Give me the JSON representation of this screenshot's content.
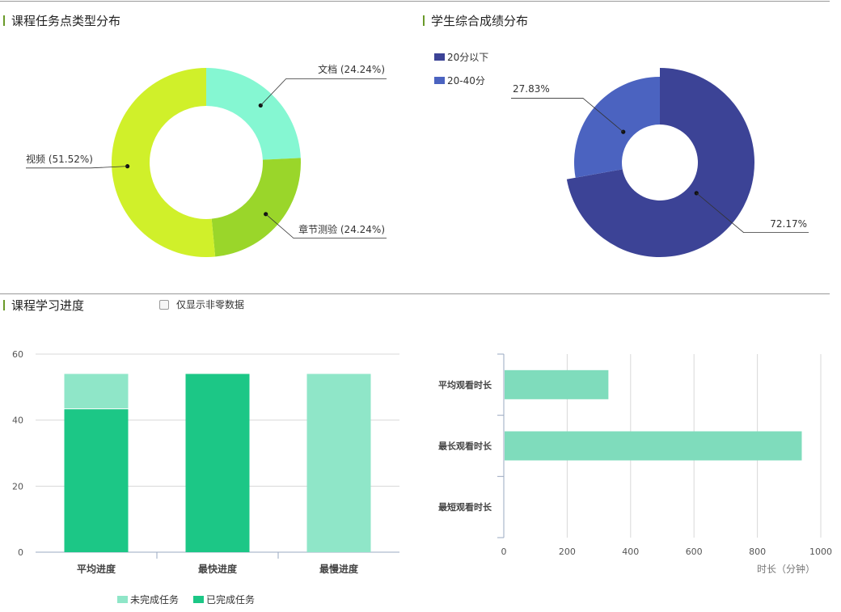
{
  "sections": {
    "task_type_title": "课程任务点类型分布",
    "score_title": "学生综合成绩分布",
    "progress_title": "课程学习进度"
  },
  "filter": {
    "nonzero_label": "仅显示非零数据",
    "checked": false
  },
  "colors": {
    "title_marker": "#6a9a2a",
    "doc": "#85f7d2",
    "quiz": "#9ad62a",
    "video": "#d0f02a",
    "below20": "#3c4396",
    "range20_40": "#4b63c0",
    "unfinished": "#8fe6c8",
    "finished": "#1cc786",
    "duration_bar": "#7fdcbc"
  },
  "chart_data": [
    {
      "type": "pie",
      "subtype": "donut",
      "title": "课程任务点类型分布",
      "slices": [
        {
          "name": "文档",
          "value": 24.24,
          "label": "文档 (24.24%)"
        },
        {
          "name": "章节测验",
          "value": 24.24,
          "label": "章节测验 (24.24%)"
        },
        {
          "name": "视频",
          "value": 51.52,
          "label": "视频 (51.52%)"
        }
      ]
    },
    {
      "type": "pie",
      "subtype": "donut",
      "title": "学生综合成绩分布",
      "legend_position": "top-left",
      "slices": [
        {
          "name": "20分以下",
          "value": 72.17,
          "label": "72.17%"
        },
        {
          "name": "20-40分",
          "value": 27.83,
          "label": "27.83%"
        }
      ]
    },
    {
      "type": "bar",
      "subtype": "stacked",
      "categories": [
        "平均进度",
        "最快进度",
        "最慢进度"
      ],
      "series": [
        {
          "name": "已完成任务",
          "values": [
            43.3,
            54,
            0
          ]
        },
        {
          "name": "未完成任务",
          "values": [
            10.7,
            0,
            54
          ]
        }
      ],
      "legend_order": [
        "未完成任务",
        "已完成任务"
      ],
      "legend_position": "bottom",
      "ylim": [
        0,
        60
      ],
      "yticks": [
        0,
        20,
        40,
        60
      ],
      "grid": true
    },
    {
      "type": "bar",
      "orientation": "horizontal",
      "categories": [
        "平均观看时长",
        "最长观看时长",
        "最短观看时长"
      ],
      "values": [
        330,
        940,
        0
      ],
      "xlabel": "时长（分钟）",
      "xlim": [
        0,
        1000
      ],
      "xticks": [
        0,
        200,
        400,
        600,
        800,
        1000
      ],
      "grid": true
    }
  ]
}
